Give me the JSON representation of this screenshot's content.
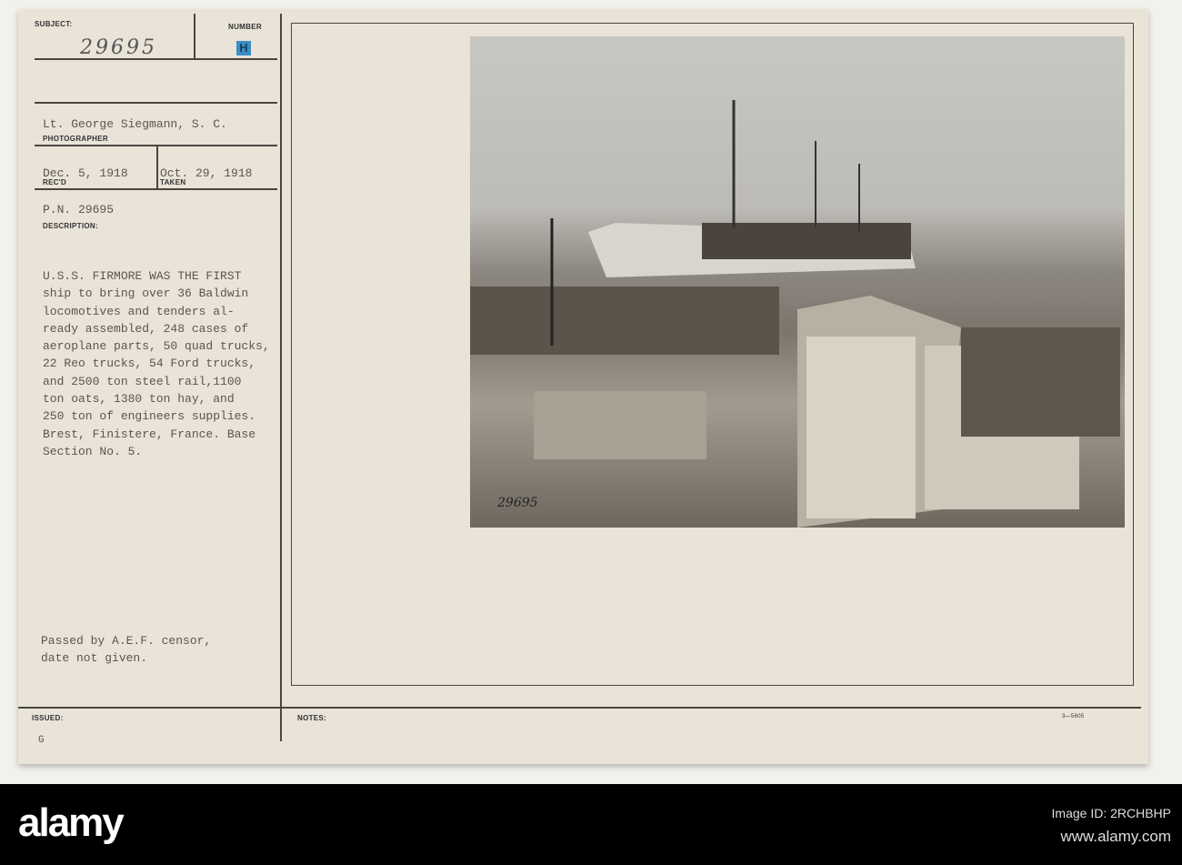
{
  "card": {
    "subject_label": "SUBJECT:",
    "subject_value": "29695",
    "number_label": "NUMBER",
    "number_stamp": "H",
    "photographer_value": "Lt. George Siegmann, S. C.",
    "photographer_label": "PHOTOGRAPHER",
    "received_value": "Dec. 5, 1918",
    "received_label": "REC'D",
    "taken_value": "Oct. 29, 1918",
    "taken_label": "TAKEN",
    "pn_value": "P.N. 29695",
    "description_label": "DESCRIPTION:",
    "description_lines": [
      "U.S.S. FIRMORE WAS THE FIRST",
      "ship to bring over 36 Baldwin",
      "locomotives and tenders al-",
      "ready assembled, 248 cases of",
      "aeroplane parts, 50 quad trucks,",
      "22 Reo trucks, 54 Ford trucks,",
      "and 2500 ton steel rail,1100",
      "ton oats, 1380 ton hay, and",
      "250 ton of engineers supplies.",
      "Brest, Finistere, France. Base",
      "Section No. 5."
    ],
    "censor_lines": [
      "Passed by A.E.F. censor,",
      "date not given."
    ],
    "issued_label": "ISSUED:",
    "issued_value": "G",
    "notes_label": "NOTES:",
    "form_number": "3—5605",
    "photo_number": "29695"
  },
  "footer": {
    "logo": "alamy",
    "image_id": "Image ID: 2RCHBHP",
    "website": "www.alamy.com"
  }
}
